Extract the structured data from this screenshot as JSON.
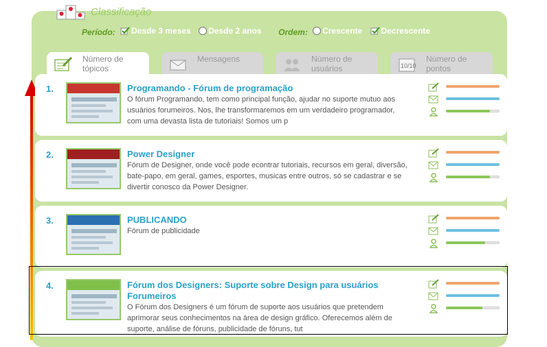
{
  "header": {
    "title": "Classificação"
  },
  "filters": {
    "period_label": "Período:",
    "period_options": [
      {
        "label": "Desde 3 meses",
        "selected": true
      },
      {
        "label": "Desde 2 anos",
        "selected": false
      }
    ],
    "order_label": "Ordem:",
    "order_options": [
      {
        "label": "Crescente",
        "selected": false
      },
      {
        "label": "Decrescente",
        "selected": true
      }
    ]
  },
  "tabs": [
    {
      "label": "Número de tópicos",
      "icon": "topics-icon",
      "active": true
    },
    {
      "label": "Mensagens",
      "icon": "envelope-icon",
      "active": false
    },
    {
      "label": "Número de usuários",
      "icon": "users-icon",
      "active": false
    },
    {
      "label": "Número de pontos",
      "icon": "points-icon",
      "active": false
    }
  ],
  "rows": [
    {
      "rank": "1.",
      "name": "Programando - Fórum de programação",
      "desc": "O fórum Programando, tem como principal função, ajudar no suporte mutuo aos usuários forumeiros. Nos, lhe transformaremos em um verdadeiro programador, com uma devasta lista de tutoriais! Somos um p",
      "thumb_color": "#c8372e",
      "stats": [
        1.0,
        1.0,
        0.82
      ]
    },
    {
      "rank": "2.",
      "name": "Power Designer",
      "desc": "Fórum de Designer, onde você pode econtrar tutoriais, recursos em geral, diversão, bate-papo, em geral, games, esportes, musicas entre outros, só se cadastrar e se divertir conosco da Power Designer.",
      "thumb_color": "#9e1f1f",
      "stats": [
        1.0,
        1.0,
        0.82
      ]
    },
    {
      "rank": "3.",
      "name": "PUBLICANDO",
      "desc": "Fórum de publicidade",
      "thumb_color": "#2a6fb0",
      "stats": [
        1.0,
        1.0,
        0.73
      ]
    },
    {
      "rank": "4.",
      "name": "Fórum dos Designers: Suporte sobre Design para usuários Forumeiros",
      "desc": "O Fórum dos Designers é um fórum de suporte aos usuários que pretendem aprimorar seus conhecimentos na área de design gráfico. Oferecemos além de suporte, análise de fóruns, publicidade de fóruns, tut",
      "thumb_color": "#7fc04a",
      "stats": [
        1.0,
        1.0,
        0.68
      ]
    }
  ],
  "colors": {
    "accent": "#2aa1c8",
    "panel": "#c8e3a2",
    "topics_bar": "#f0a56c",
    "messages_bar": "#6cc0e0",
    "users_bar": "#8cc65a"
  }
}
